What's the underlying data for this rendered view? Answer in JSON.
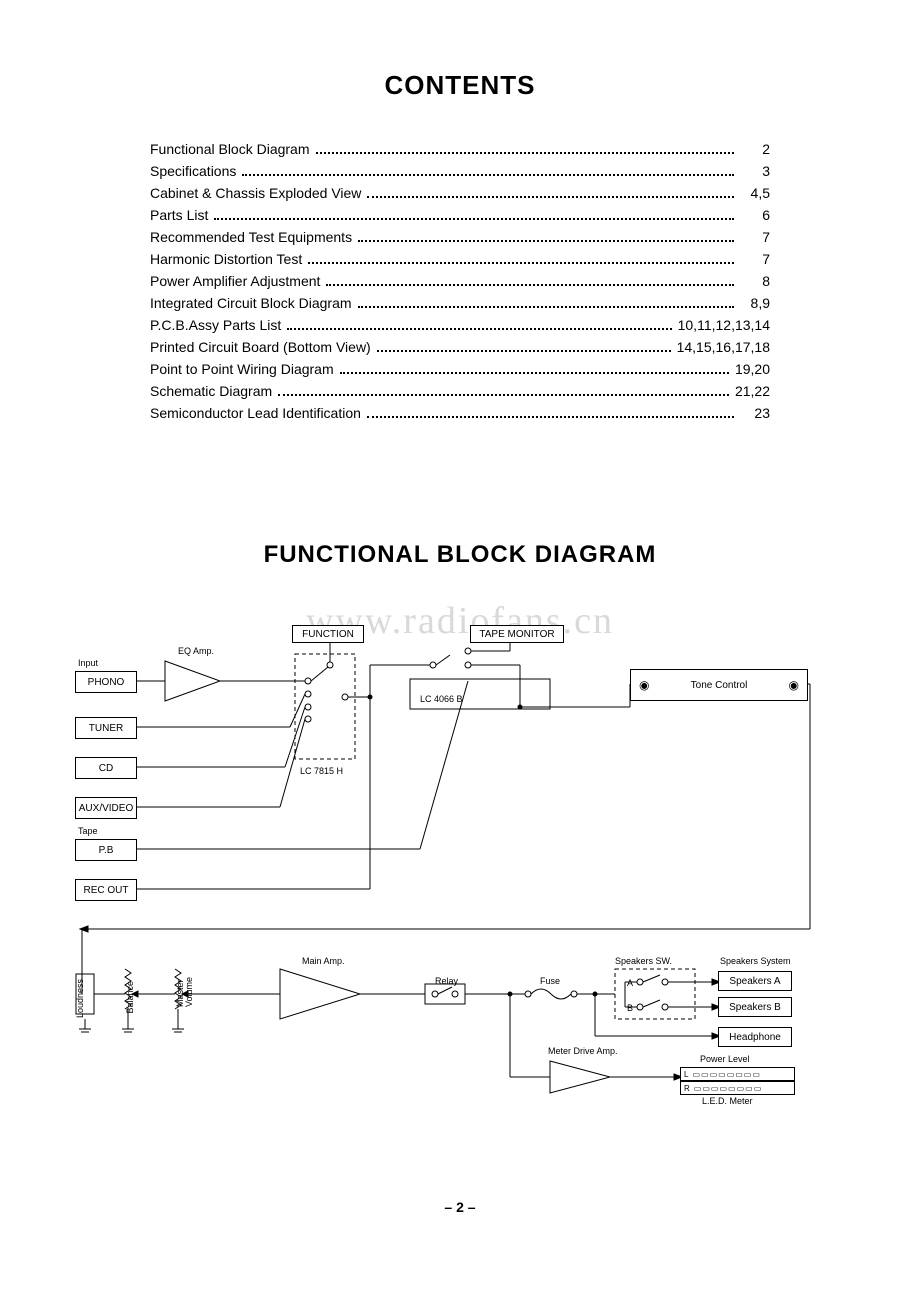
{
  "headings": {
    "contents": "CONTENTS",
    "block_diagram": "FUNCTIONAL BLOCK DIAGRAM"
  },
  "toc": [
    {
      "label": "Functional Block Diagram",
      "page": "2"
    },
    {
      "label": "Specifications",
      "page": "3"
    },
    {
      "label": "Cabinet & Chassis Exploded View",
      "page": "4,5"
    },
    {
      "label": "Parts List",
      "page": "6"
    },
    {
      "label": "Recommended Test Equipments",
      "page": "7"
    },
    {
      "label": "Harmonic Distortion Test",
      "page": "7"
    },
    {
      "label": "Power Amplifier Adjustment",
      "page": "8"
    },
    {
      "label": "Integrated Circuit Block Diagram",
      "page": "8,9"
    },
    {
      "label": "P.C.B.Assy Parts List",
      "page": "10,11,12,13,14"
    },
    {
      "label": "Printed Circuit Board (Bottom View)",
      "page": "14,15,16,17,18"
    },
    {
      "label": "Point to Point Wiring Diagram",
      "page": "19,20"
    },
    {
      "label": "Schematic Diagram",
      "page": "21,22"
    },
    {
      "label": "Semiconductor Lead Identification",
      "page": "23"
    }
  ],
  "watermark": "www.radiofans.cn",
  "diagram": {
    "inputs_heading": "Input",
    "inputs": {
      "phono": "PHONO",
      "tuner": "TUNER",
      "cd": "CD",
      "aux": "AUX/VIDEO",
      "tape_heading": "Tape",
      "pb": "P.B",
      "rec_out": "REC OUT"
    },
    "blocks": {
      "eq_amp": "EQ Amp.",
      "function": "FUNCTION",
      "tape_monitor": "TAPE MONITOR",
      "lc4066b": "LC 4066 B",
      "lc7815h": "LC 7815 H",
      "tone_control": "Tone Control",
      "main_amp": "Main Amp.",
      "relay": "Relay",
      "fuse": "Fuse",
      "speakers_sw": "Speakers SW.",
      "speakers_system": "Speakers System",
      "speakers_a": "Speakers A",
      "speakers_b": "Speakers B",
      "headphone": "Headphone",
      "meter_drive": "Meter Drive Amp.",
      "power_level": "Power Level",
      "led_meter": "L.E.D. Meter",
      "sw_a": "A",
      "sw_b": "B",
      "meter_l": "L",
      "meter_r": "R"
    },
    "controls": {
      "loudness": "Loudness",
      "balance": "Balance",
      "master_volume": "Master\nVolume"
    }
  },
  "page_number": "– 2 –"
}
